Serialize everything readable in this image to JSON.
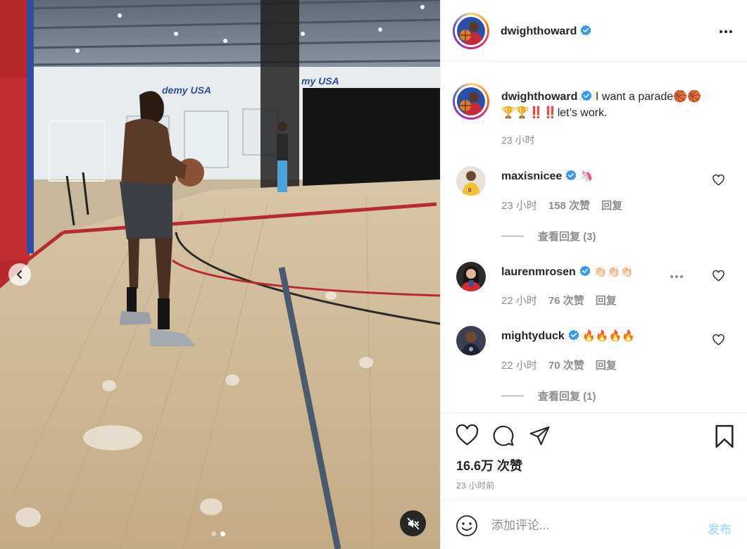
{
  "media": {
    "wall_sign_left": "demy USA",
    "wall_sign_right": "my USA",
    "carousel_count": 2,
    "carousel_active_index": 1,
    "prev_icon": "chevron-left-icon",
    "mute_icon": "speaker-muted-icon"
  },
  "post": {
    "author": "dwighthoward",
    "author_verified": true,
    "caption_username": "dwighthoward",
    "caption_line1": "I want a parade🏀🏀",
    "caption_line2": "🏆🏆‼️‼️let’s work.",
    "caption_time": "23 小时",
    "likes": "16.6万 次赞",
    "posted_ago": "23 小时前"
  },
  "comments": [
    {
      "username": "maxisnicee",
      "verified": true,
      "text": "🦄",
      "time": "23 小时",
      "likes": "158 次赞",
      "reply_label": "回复",
      "view_replies": "查看回复 (3)"
    },
    {
      "username": "laurenmrosen",
      "verified": true,
      "text": "👏🏻👏🏻👏🏻",
      "time": "22 小时",
      "likes": "76 次赞",
      "reply_label": "回复"
    },
    {
      "username": "mightyduck",
      "verified": true,
      "text": "🔥🔥🔥🔥",
      "time": "22 小时",
      "likes": "70 次赞",
      "reply_label": "回复",
      "view_replies": "查看回复 (1)"
    }
  ],
  "compose": {
    "placeholder": "添加评论...",
    "post_label": "发布"
  },
  "colors": {
    "verified_blue": "#3897f0",
    "muted_text": "#8e8e8e",
    "post_button_disabled": "#b2dffc",
    "court_red": "#b92a2e"
  }
}
